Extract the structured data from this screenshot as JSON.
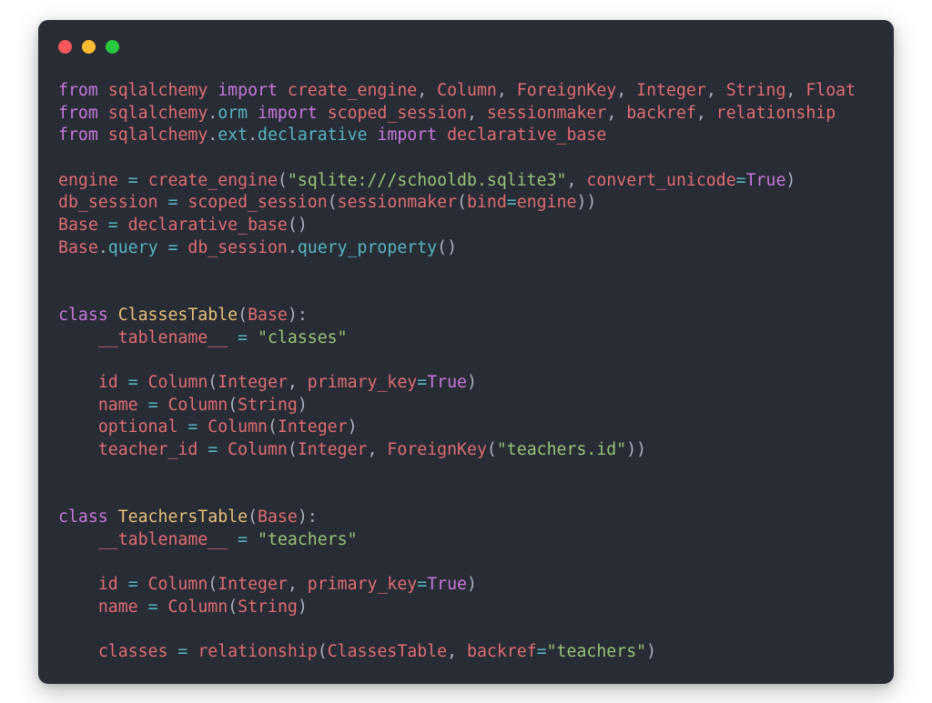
{
  "window": {
    "background": "#282c34",
    "corner_radius_px": 11,
    "traffic_lights": [
      {
        "name": "close-button-dot",
        "label": "close",
        "color": "#f9575a"
      },
      {
        "name": "minimize-button-dot",
        "label": "minimize",
        "color": "#febc2e"
      },
      {
        "name": "maximize-button-dot",
        "label": "maximize",
        "color": "#28c840"
      }
    ]
  },
  "theme": {
    "name": "one-dark",
    "background": "#282c34",
    "keyword": "#c678dd",
    "name_red": "#e06c75",
    "string_green": "#98c379",
    "operator_cyan": "#56b6c2",
    "class_yellow": "#e5c07b",
    "constant_purple": "#c678dd",
    "punctuation": "#abb2bf",
    "module_cyan": "#56b6c2"
  },
  "code": {
    "language": "python",
    "plain_text": "from sqlalchemy import create_engine, Column, ForeignKey, Integer, String, Float\nfrom sqlalchemy.orm import scoped_session, sessionmaker, backref, relationship\nfrom sqlalchemy.ext.declarative import declarative_base\n\nengine = create_engine(\"sqlite:///schooldb.sqlite3\", convert_unicode=True)\ndb_session = scoped_session(sessionmaker(bind=engine))\nBase = declarative_base()\nBase.query = db_session.query_property()\n\n\nclass ClassesTable(Base):\n    __tablename__ = \"classes\"\n\n    id = Column(Integer, primary_key=True)\n    name = Column(String)\n    optional = Column(Integer)\n    teacher_id = Column(Integer, ForeignKey(\"teachers.id\"))\n\n\nclass TeachersTable(Base):\n    __tablename__ = \"teachers\"\n\n    id = Column(Integer, primary_key=True)\n    name = Column(String)\n\n    classes = relationship(ClassesTable, backref=\"teachers\")\n",
    "lines": [
      [
        {
          "t": "from",
          "c": "keyword"
        },
        {
          "t": " ",
          "c": "plain"
        },
        {
          "t": "sqlalchemy",
          "c": "name_red"
        },
        {
          "t": " ",
          "c": "plain"
        },
        {
          "t": "import",
          "c": "keyword"
        },
        {
          "t": " ",
          "c": "plain"
        },
        {
          "t": "create_engine",
          "c": "name_red"
        },
        {
          "t": ", ",
          "c": "punct"
        },
        {
          "t": "Column",
          "c": "name_red"
        },
        {
          "t": ", ",
          "c": "punct"
        },
        {
          "t": "ForeignKey",
          "c": "name_red"
        },
        {
          "t": ", ",
          "c": "punct"
        },
        {
          "t": "Integer",
          "c": "name_red"
        },
        {
          "t": ", ",
          "c": "punct"
        },
        {
          "t": "String",
          "c": "name_red"
        },
        {
          "t": ", ",
          "c": "punct"
        },
        {
          "t": "Float",
          "c": "name_red"
        }
      ],
      [
        {
          "t": "from",
          "c": "keyword"
        },
        {
          "t": " ",
          "c": "plain"
        },
        {
          "t": "sqlalchemy",
          "c": "name_red"
        },
        {
          "t": ".",
          "c": "punct"
        },
        {
          "t": "orm",
          "c": "module_cyan"
        },
        {
          "t": " ",
          "c": "plain"
        },
        {
          "t": "import",
          "c": "keyword"
        },
        {
          "t": " ",
          "c": "plain"
        },
        {
          "t": "scoped_session",
          "c": "name_red"
        },
        {
          "t": ", ",
          "c": "punct"
        },
        {
          "t": "sessionmaker",
          "c": "name_red"
        },
        {
          "t": ", ",
          "c": "punct"
        },
        {
          "t": "backref",
          "c": "name_red"
        },
        {
          "t": ", ",
          "c": "punct"
        },
        {
          "t": "relationship",
          "c": "name_red"
        }
      ],
      [
        {
          "t": "from",
          "c": "keyword"
        },
        {
          "t": " ",
          "c": "plain"
        },
        {
          "t": "sqlalchemy",
          "c": "name_red"
        },
        {
          "t": ".",
          "c": "punct"
        },
        {
          "t": "ext",
          "c": "module_cyan"
        },
        {
          "t": ".",
          "c": "punct"
        },
        {
          "t": "declarative",
          "c": "module_cyan"
        },
        {
          "t": " ",
          "c": "plain"
        },
        {
          "t": "import",
          "c": "keyword"
        },
        {
          "t": " ",
          "c": "plain"
        },
        {
          "t": "declarative_base",
          "c": "name_red"
        }
      ],
      [],
      [
        {
          "t": "engine",
          "c": "name_red"
        },
        {
          "t": " ",
          "c": "plain"
        },
        {
          "t": "=",
          "c": "operator_cyan"
        },
        {
          "t": " ",
          "c": "plain"
        },
        {
          "t": "create_engine",
          "c": "name_red"
        },
        {
          "t": "(",
          "c": "punct"
        },
        {
          "t": "\"sqlite:///schooldb.sqlite3\"",
          "c": "string_green"
        },
        {
          "t": ", ",
          "c": "punct"
        },
        {
          "t": "convert_unicode",
          "c": "name_red"
        },
        {
          "t": "=",
          "c": "operator_cyan"
        },
        {
          "t": "True",
          "c": "constant_purple"
        },
        {
          "t": ")",
          "c": "punct"
        }
      ],
      [
        {
          "t": "db_session",
          "c": "name_red"
        },
        {
          "t": " ",
          "c": "plain"
        },
        {
          "t": "=",
          "c": "operator_cyan"
        },
        {
          "t": " ",
          "c": "plain"
        },
        {
          "t": "scoped_session",
          "c": "name_red"
        },
        {
          "t": "(",
          "c": "punct"
        },
        {
          "t": "sessionmaker",
          "c": "name_red"
        },
        {
          "t": "(",
          "c": "punct"
        },
        {
          "t": "bind",
          "c": "name_red"
        },
        {
          "t": "=",
          "c": "operator_cyan"
        },
        {
          "t": "engine",
          "c": "name_red"
        },
        {
          "t": "))",
          "c": "punct"
        }
      ],
      [
        {
          "t": "Base",
          "c": "name_red"
        },
        {
          "t": " ",
          "c": "plain"
        },
        {
          "t": "=",
          "c": "operator_cyan"
        },
        {
          "t": " ",
          "c": "plain"
        },
        {
          "t": "declarative_base",
          "c": "name_red"
        },
        {
          "t": "()",
          "c": "punct"
        }
      ],
      [
        {
          "t": "Base",
          "c": "name_red"
        },
        {
          "t": ".",
          "c": "punct"
        },
        {
          "t": "query",
          "c": "module_cyan"
        },
        {
          "t": " ",
          "c": "plain"
        },
        {
          "t": "=",
          "c": "operator_cyan"
        },
        {
          "t": " ",
          "c": "plain"
        },
        {
          "t": "db_session",
          "c": "name_red"
        },
        {
          "t": ".",
          "c": "punct"
        },
        {
          "t": "query_property",
          "c": "module_cyan"
        },
        {
          "t": "()",
          "c": "punct"
        }
      ],
      [],
      [],
      [
        {
          "t": "class",
          "c": "keyword"
        },
        {
          "t": " ",
          "c": "plain"
        },
        {
          "t": "ClassesTable",
          "c": "class_yellow"
        },
        {
          "t": "(",
          "c": "punct"
        },
        {
          "t": "Base",
          "c": "name_red"
        },
        {
          "t": "):",
          "c": "punct"
        }
      ],
      [
        {
          "t": "    ",
          "c": "plain"
        },
        {
          "t": "__tablename__",
          "c": "name_red"
        },
        {
          "t": " ",
          "c": "plain"
        },
        {
          "t": "=",
          "c": "operator_cyan"
        },
        {
          "t": " ",
          "c": "plain"
        },
        {
          "t": "\"classes\"",
          "c": "string_green"
        }
      ],
      [],
      [
        {
          "t": "    ",
          "c": "plain"
        },
        {
          "t": "id",
          "c": "name_red"
        },
        {
          "t": " ",
          "c": "plain"
        },
        {
          "t": "=",
          "c": "operator_cyan"
        },
        {
          "t": " ",
          "c": "plain"
        },
        {
          "t": "Column",
          "c": "name_red"
        },
        {
          "t": "(",
          "c": "punct"
        },
        {
          "t": "Integer",
          "c": "name_red"
        },
        {
          "t": ", ",
          "c": "punct"
        },
        {
          "t": "primary_key",
          "c": "name_red"
        },
        {
          "t": "=",
          "c": "operator_cyan"
        },
        {
          "t": "True",
          "c": "constant_purple"
        },
        {
          "t": ")",
          "c": "punct"
        }
      ],
      [
        {
          "t": "    ",
          "c": "plain"
        },
        {
          "t": "name",
          "c": "name_red"
        },
        {
          "t": " ",
          "c": "plain"
        },
        {
          "t": "=",
          "c": "operator_cyan"
        },
        {
          "t": " ",
          "c": "plain"
        },
        {
          "t": "Column",
          "c": "name_red"
        },
        {
          "t": "(",
          "c": "punct"
        },
        {
          "t": "String",
          "c": "name_red"
        },
        {
          "t": ")",
          "c": "punct"
        }
      ],
      [
        {
          "t": "    ",
          "c": "plain"
        },
        {
          "t": "optional",
          "c": "name_red"
        },
        {
          "t": " ",
          "c": "plain"
        },
        {
          "t": "=",
          "c": "operator_cyan"
        },
        {
          "t": " ",
          "c": "plain"
        },
        {
          "t": "Column",
          "c": "name_red"
        },
        {
          "t": "(",
          "c": "punct"
        },
        {
          "t": "Integer",
          "c": "name_red"
        },
        {
          "t": ")",
          "c": "punct"
        }
      ],
      [
        {
          "t": "    ",
          "c": "plain"
        },
        {
          "t": "teacher_id",
          "c": "name_red"
        },
        {
          "t": " ",
          "c": "plain"
        },
        {
          "t": "=",
          "c": "operator_cyan"
        },
        {
          "t": " ",
          "c": "plain"
        },
        {
          "t": "Column",
          "c": "name_red"
        },
        {
          "t": "(",
          "c": "punct"
        },
        {
          "t": "Integer",
          "c": "name_red"
        },
        {
          "t": ", ",
          "c": "punct"
        },
        {
          "t": "ForeignKey",
          "c": "name_red"
        },
        {
          "t": "(",
          "c": "punct"
        },
        {
          "t": "\"teachers.id\"",
          "c": "string_green"
        },
        {
          "t": "))",
          "c": "punct"
        }
      ],
      [],
      [],
      [
        {
          "t": "class",
          "c": "keyword"
        },
        {
          "t": " ",
          "c": "plain"
        },
        {
          "t": "TeachersTable",
          "c": "class_yellow"
        },
        {
          "t": "(",
          "c": "punct"
        },
        {
          "t": "Base",
          "c": "name_red"
        },
        {
          "t": "):",
          "c": "punct"
        }
      ],
      [
        {
          "t": "    ",
          "c": "plain"
        },
        {
          "t": "__tablename__",
          "c": "name_red"
        },
        {
          "t": " ",
          "c": "plain"
        },
        {
          "t": "=",
          "c": "operator_cyan"
        },
        {
          "t": " ",
          "c": "plain"
        },
        {
          "t": "\"teachers\"",
          "c": "string_green"
        }
      ],
      [],
      [
        {
          "t": "    ",
          "c": "plain"
        },
        {
          "t": "id",
          "c": "name_red"
        },
        {
          "t": " ",
          "c": "plain"
        },
        {
          "t": "=",
          "c": "operator_cyan"
        },
        {
          "t": " ",
          "c": "plain"
        },
        {
          "t": "Column",
          "c": "name_red"
        },
        {
          "t": "(",
          "c": "punct"
        },
        {
          "t": "Integer",
          "c": "name_red"
        },
        {
          "t": ", ",
          "c": "punct"
        },
        {
          "t": "primary_key",
          "c": "name_red"
        },
        {
          "t": "=",
          "c": "operator_cyan"
        },
        {
          "t": "True",
          "c": "constant_purple"
        },
        {
          "t": ")",
          "c": "punct"
        }
      ],
      [
        {
          "t": "    ",
          "c": "plain"
        },
        {
          "t": "name",
          "c": "name_red"
        },
        {
          "t": " ",
          "c": "plain"
        },
        {
          "t": "=",
          "c": "operator_cyan"
        },
        {
          "t": " ",
          "c": "plain"
        },
        {
          "t": "Column",
          "c": "name_red"
        },
        {
          "t": "(",
          "c": "punct"
        },
        {
          "t": "String",
          "c": "name_red"
        },
        {
          "t": ")",
          "c": "punct"
        }
      ],
      [],
      [
        {
          "t": "    ",
          "c": "plain"
        },
        {
          "t": "classes",
          "c": "name_red"
        },
        {
          "t": " ",
          "c": "plain"
        },
        {
          "t": "=",
          "c": "operator_cyan"
        },
        {
          "t": " ",
          "c": "plain"
        },
        {
          "t": "relationship",
          "c": "name_red"
        },
        {
          "t": "(",
          "c": "punct"
        },
        {
          "t": "ClassesTable",
          "c": "name_red"
        },
        {
          "t": ", ",
          "c": "punct"
        },
        {
          "t": "backref",
          "c": "name_red"
        },
        {
          "t": "=",
          "c": "operator_cyan"
        },
        {
          "t": "\"teachers\"",
          "c": "string_green"
        },
        {
          "t": ")",
          "c": "punct"
        }
      ]
    ]
  }
}
